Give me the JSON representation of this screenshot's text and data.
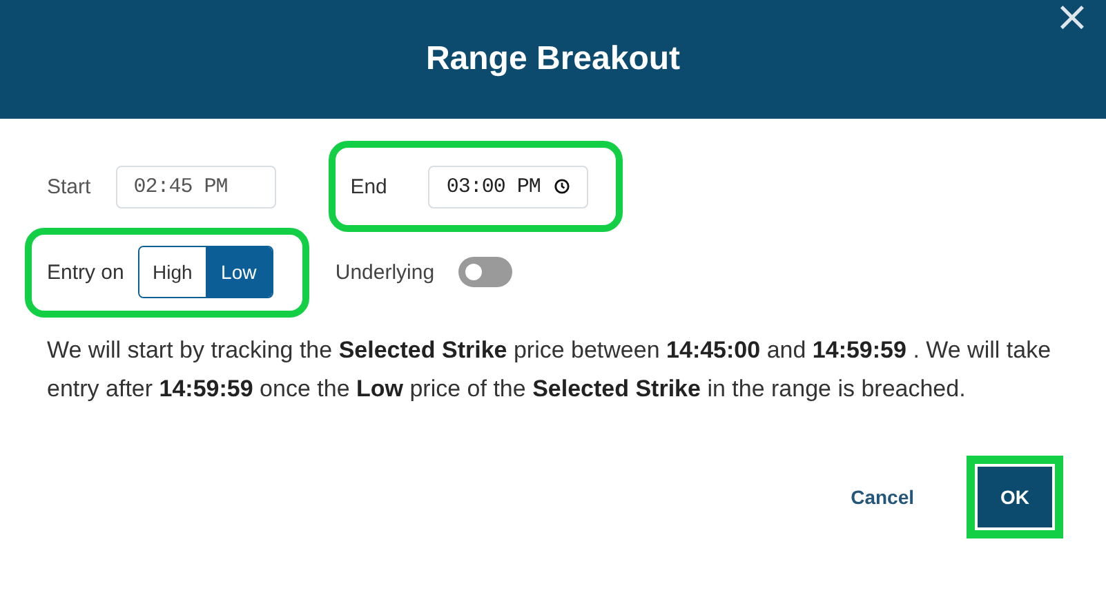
{
  "dialog": {
    "title": "Range Breakout",
    "close": "×"
  },
  "start": {
    "label": "Start",
    "value": "02:45 PM",
    "highlighted": false
  },
  "end": {
    "label": "End",
    "value": "03:00 PM",
    "highlighted": true
  },
  "entry_on": {
    "label": "Entry on",
    "highlighted": true,
    "options": [
      {
        "label": "High",
        "selected": false
      },
      {
        "label": "Low",
        "selected": true
      }
    ]
  },
  "underlying": {
    "label": "Underlying",
    "on": false
  },
  "description": "We will start by tracking the **Selected Strike** price between **14:45:00** and **14:59:59** . We will take entry after **14:59:59** once the **Low** price of the **Selected Strike** in the range is breached.",
  "buttons": [
    {
      "label": "Cancel",
      "kind": "link",
      "highlighted": false
    },
    {
      "label": "OK",
      "kind": "primary",
      "highlighted": true
    }
  ]
}
